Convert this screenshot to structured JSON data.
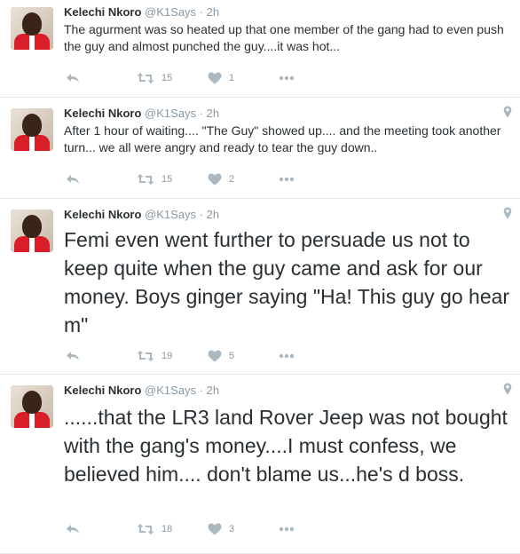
{
  "tweets": [
    {
      "name": "Kelechi Nkoro",
      "handle": "@K1Says",
      "sep": "·",
      "time": "2h",
      "text": "The agurment was so heated up that one member of the gang had to even push the guy and almost punched the guy....it was hot...",
      "retweets": "15",
      "likes": "1"
    },
    {
      "name": "Kelechi Nkoro",
      "handle": "@K1Says",
      "sep": "·",
      "time": "2h",
      "text": "After 1 hour of waiting.... \"The Guy\" showed up.... and the meeting took another turn... we all were angry and ready to tear the guy down..",
      "retweets": "15",
      "likes": "2"
    },
    {
      "name": "Kelechi Nkoro",
      "handle": "@K1Says",
      "sep": "·",
      "time": "2h",
      "text": "Femi even went further to persuade us not to keep quite when the guy came and ask for our money. Boys ginger saying \"Ha! This guy go hear m\"",
      "retweets": "19",
      "likes": "5"
    },
    {
      "name": "Kelechi Nkoro",
      "handle": "@K1Says",
      "sep": "·",
      "time": "2h",
      "text": "......that the LR3 land Rover Jeep was not bought with the gang's money....I must confess, we believed him.... don't blame us...he's d boss.",
      "retweets": "18",
      "likes": "3"
    }
  ],
  "icons": {
    "reply": "reply-icon",
    "retweet": "retweet-icon",
    "like": "heart-icon",
    "more": "more-icon",
    "location": "location-pin-icon"
  },
  "colors": {
    "name": "#292f33",
    "meta": "#8899a6",
    "icon": "#aab8c2",
    "divider": "#e1e8ed"
  }
}
